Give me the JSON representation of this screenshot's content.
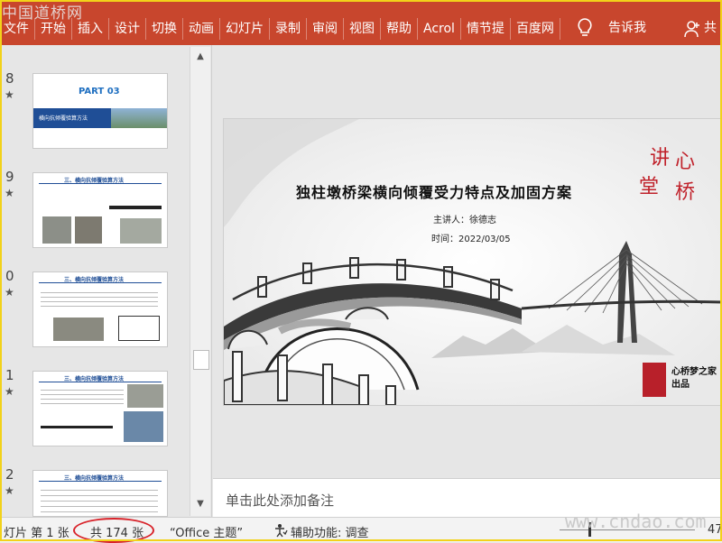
{
  "watermark_top": "中国道桥网",
  "ribbon": {
    "tabs": [
      "文件",
      "开始",
      "插入",
      "设计",
      "切换",
      "动画",
      "幻灯片",
      "录制",
      "审阅",
      "视图",
      "帮助",
      "Acrol",
      "情节提",
      "百度网"
    ],
    "tell_me": "告诉我",
    "share": "共"
  },
  "thumbnails": [
    {
      "num": "8",
      "star": "★",
      "part_title": "PART  03",
      "bar_text": "横向抗倾覆验算方法"
    },
    {
      "num": "9",
      "star": "★",
      "heading": "三、横向抗倾覆验算方法"
    },
    {
      "num": "0",
      "star": "★",
      "heading": "三、横向抗倾覆验算方法"
    },
    {
      "num": "1",
      "star": "★",
      "heading": "三、横向抗倾覆验算方法"
    },
    {
      "num": "2",
      "star": "★",
      "heading": "三、横向抗倾覆验算方法"
    }
  ],
  "slide": {
    "title": "独柱墩桥梁横向倾覆受力特点及加固方案",
    "speaker": "主讲人：徐德志",
    "date": "时间：2022/03/05",
    "logo": "讲心堂桥",
    "brand_line1": "心桥梦之家",
    "brand_line2": "出品"
  },
  "notes_placeholder": "单击此处添加备注",
  "status": {
    "slide_info": "灯片 第 1 张",
    "total": "共 174 张",
    "theme": "“Office 主题”",
    "accessibility": "辅助功能: 调查",
    "zoom_tail": "47"
  },
  "watermark_bottom": "www.cndao.com",
  "colors": {
    "ribbon": "#c8462d",
    "annotation_circle": "#d8232a",
    "accent_blue": "#1f4e96",
    "seal": "#b8202a"
  }
}
